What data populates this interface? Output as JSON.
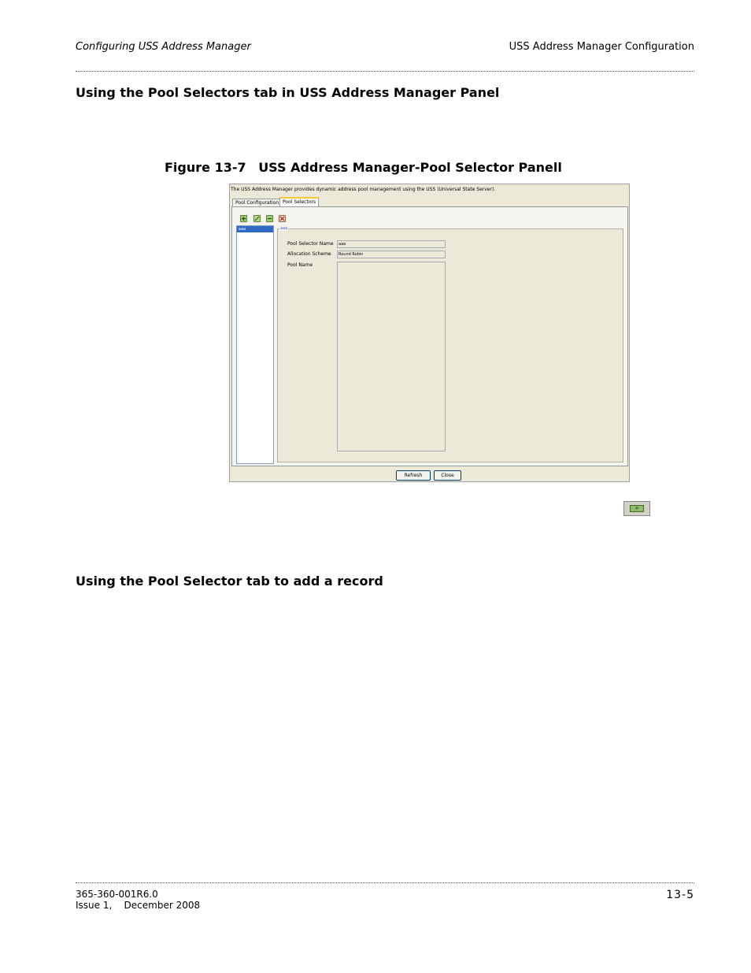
{
  "header": {
    "left": "Configuring USS Address Manager",
    "right": "USS Address Manager Configuration"
  },
  "section1_heading": "Using the Pool Selectors tab in USS Address Manager Panel",
  "figure": {
    "number": "Figure 13-7",
    "title": "USS Address Manager-Pool Selector Panell"
  },
  "panel": {
    "intro": "The USS Address Manager provides dynamic address pool management using the USS (Universal State Server).",
    "tabs": [
      "Pool Configuration",
      "Pool Selectors"
    ],
    "list_items": [
      "aaa"
    ],
    "group_title": "aaa",
    "fields": {
      "selector_name_label": "Pool Selector Name",
      "selector_name_value": "aaa",
      "allocation_label": "Allocation Scheme",
      "allocation_value": "Round Robin",
      "pool_name_label": "Pool Name"
    },
    "buttons": {
      "refresh": "Refresh",
      "close": "Close"
    }
  },
  "section2_heading": "Using the Pool Selector tab to add a record",
  "footer": {
    "doc_number": "365-360-001R6.0",
    "issue": "Issue 1,    December 2008",
    "page": "13-5"
  }
}
